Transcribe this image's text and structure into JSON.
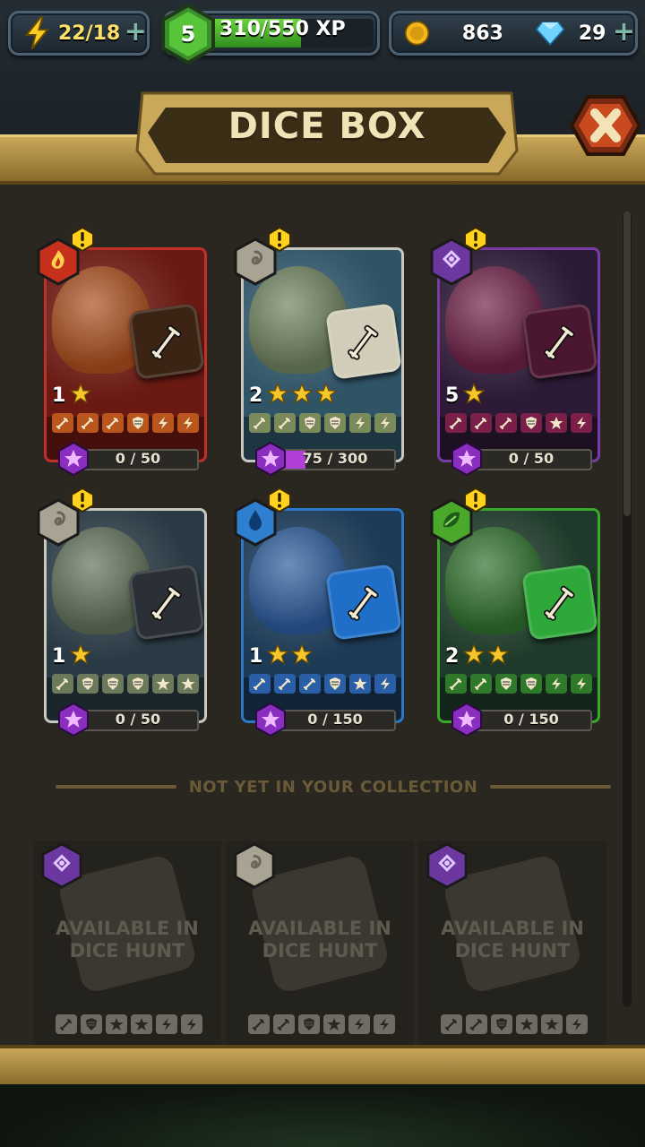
{
  "hud": {
    "energy": "22/18",
    "level": "5",
    "xp_label": "310/550 XP",
    "xp_progress": 0.56,
    "coins": "863",
    "gems": "29"
  },
  "header": {
    "title": "DICE BOX"
  },
  "cards": [
    {
      "level": "1",
      "stars": 1,
      "progress": "0 / 50",
      "fill": 0.0,
      "faces": [
        "sword",
        "sword",
        "sword",
        "shield",
        "bolt",
        "bolt"
      ],
      "element": "fire",
      "colors": {
        "frame": "#c0302a",
        "art": "#6a1a12",
        "face": "#b8561d",
        "die": "#3b2414",
        "badge": "#c8301e"
      }
    },
    {
      "level": "2",
      "stars": 3,
      "progress": "75 / 300",
      "fill": 0.25,
      "faces": [
        "sword",
        "sword",
        "shield",
        "shield",
        "bolt",
        "bolt"
      ],
      "element": "neutral",
      "colors": {
        "frame": "#c8c8c0",
        "art": "#2f5466",
        "face": "#7a8a5a",
        "die": "#d2cdb8",
        "badge": "#a8a393"
      }
    },
    {
      "level": "5",
      "stars": 1,
      "progress": "0 / 50",
      "fill": 0.0,
      "faces": [
        "sword",
        "sword",
        "sword",
        "shield",
        "star",
        "bolt"
      ],
      "element": "dark",
      "colors": {
        "frame": "#7a3aa8",
        "art": "#2d1a36",
        "face": "#7a1f48",
        "die": "#4a1630",
        "badge": "#6d37a0"
      }
    },
    {
      "level": "1",
      "stars": 1,
      "progress": "0 / 50",
      "fill": 0.0,
      "faces": [
        "sword",
        "shield",
        "shield",
        "shield",
        "star",
        "star"
      ],
      "element": "neutral",
      "colors": {
        "frame": "#c8c8c0",
        "art": "#2a3a44",
        "face": "#6a7a5a",
        "die": "#2a3035",
        "badge": "#a8a393"
      }
    },
    {
      "level": "1",
      "stars": 2,
      "progress": "0 / 150",
      "fill": 0.0,
      "faces": [
        "sword",
        "sword",
        "sword",
        "shield",
        "star",
        "bolt"
      ],
      "element": "water",
      "colors": {
        "frame": "#2a78c8",
        "art": "#1d3a56",
        "face": "#2a5fa8",
        "die": "#1f6fc8",
        "badge": "#2f7fd0"
      }
    },
    {
      "level": "2",
      "stars": 2,
      "progress": "0 / 150",
      "fill": 0.0,
      "faces": [
        "sword",
        "sword",
        "shield",
        "shield",
        "bolt",
        "bolt"
      ],
      "element": "nature",
      "colors": {
        "frame": "#3aa82a",
        "art": "#1f3a2a",
        "face": "#2f7a2a",
        "die": "#2fa83a",
        "badge": "#4aa82a"
      }
    }
  ],
  "divider": {
    "label": "NOT YET IN YOUR COLLECTION"
  },
  "locked": [
    {
      "text_line1": "AVAILABLE IN",
      "text_line2": "DICE HUNT",
      "element": "dark",
      "faces": [
        "sword",
        "shield",
        "star",
        "star",
        "bolt",
        "bolt"
      ]
    },
    {
      "text_line1": "AVAILABLE IN",
      "text_line2": "DICE HUNT",
      "element": "neutral",
      "faces": [
        "sword",
        "sword",
        "shield",
        "star",
        "bolt",
        "bolt"
      ]
    },
    {
      "text_line1": "AVAILABLE IN",
      "text_line2": "DICE HUNT",
      "element": "dark",
      "faces": [
        "sword",
        "sword",
        "shield",
        "star",
        "star",
        "bolt"
      ]
    }
  ]
}
